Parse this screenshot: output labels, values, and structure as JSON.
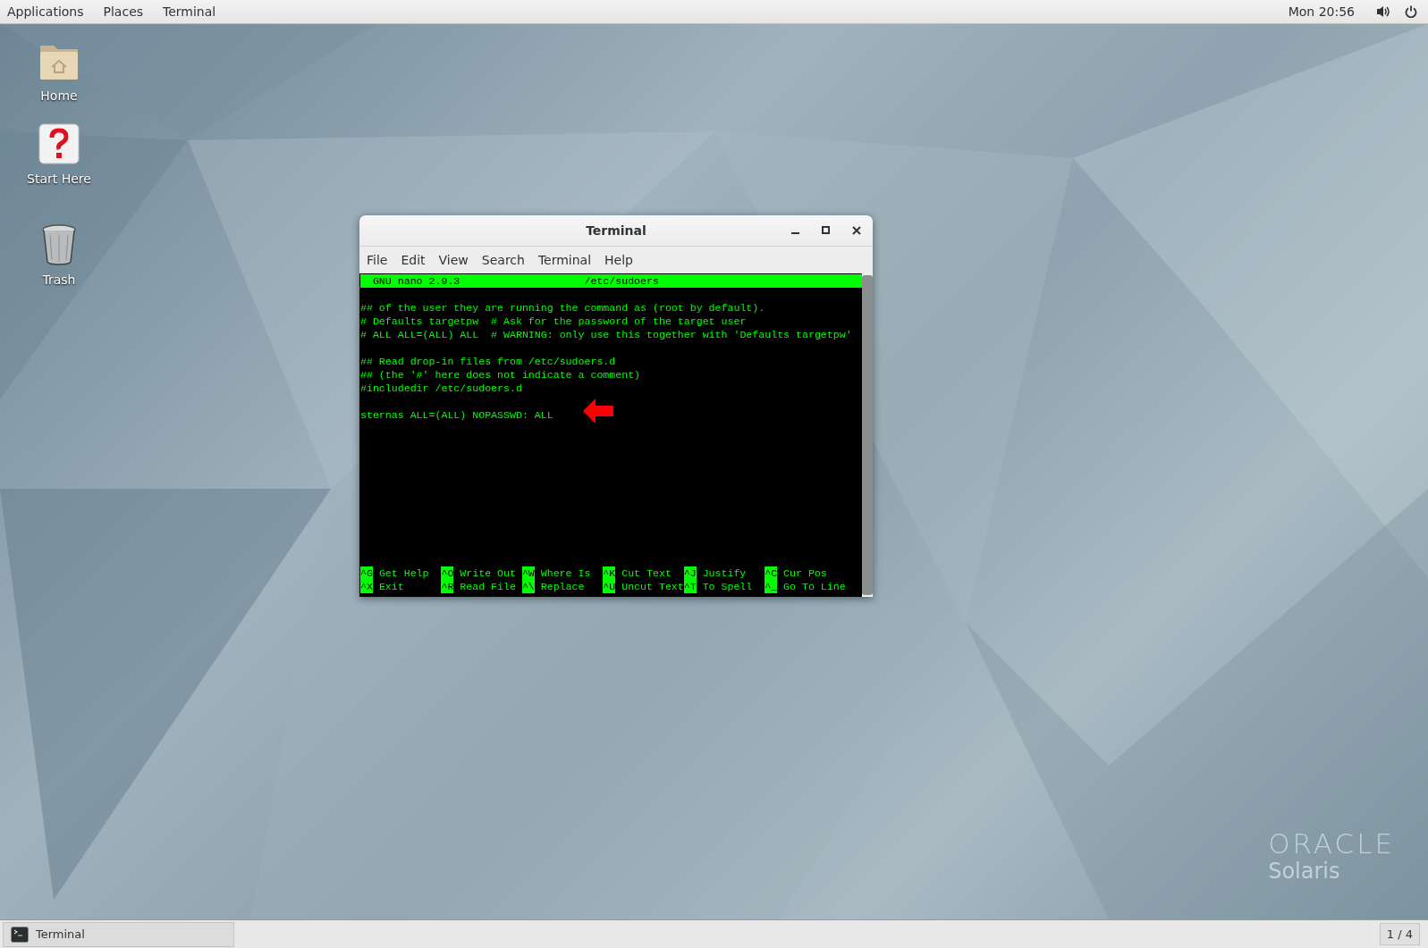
{
  "top_bar": {
    "menus": [
      "Applications",
      "Places",
      "Terminal"
    ],
    "clock": "Mon 20:56"
  },
  "desktop_icons": [
    {
      "kind": "home",
      "label": "Home"
    },
    {
      "kind": "help",
      "label": "Start Here"
    },
    {
      "kind": "trash",
      "label": "Trash"
    }
  ],
  "terminal": {
    "title": "Terminal",
    "menus": [
      "File",
      "Edit",
      "View",
      "Search",
      "Terminal",
      "Help"
    ],
    "nano": {
      "version": "GNU nano 2.9.3",
      "file": "/etc/sudoers",
      "blocks": [
        [
          "## of the user they are running the command as (root by default).",
          "# Defaults targetpw  # Ask for the password of the target user",
          "# ALL ALL=(ALL) ALL  # WARNING: only use this together with 'Defaults targetpw'"
        ],
        [
          "## Read drop-in files from /etc/sudoers.d",
          "## (the '#' here does not indicate a comment)",
          "#includedir /etc/sudoers.d"
        ],
        [
          "sternas ALL=(ALL) NOPASSWD: ALL"
        ]
      ],
      "shortcuts": [
        [
          {
            "key": "^G",
            "label": "Get Help"
          },
          {
            "key": "^O",
            "label": "Write Out"
          },
          {
            "key": "^W",
            "label": "Where Is"
          },
          {
            "key": "^K",
            "label": "Cut Text"
          },
          {
            "key": "^J",
            "label": "Justify"
          },
          {
            "key": "^C",
            "label": "Cur Pos"
          }
        ],
        [
          {
            "key": "^X",
            "label": "Exit"
          },
          {
            "key": "^R",
            "label": "Read File"
          },
          {
            "key": "^\\",
            "label": "Replace"
          },
          {
            "key": "^U",
            "label": "Uncut Text"
          },
          {
            "key": "^T",
            "label": "To Spell"
          },
          {
            "key": "^_",
            "label": "Go To Line"
          }
        ]
      ]
    }
  },
  "wallpaper_logo": {
    "brand": "ORACLE",
    "product": "Solaris"
  },
  "taskbar": {
    "tasks": [
      {
        "label": "Terminal"
      }
    ],
    "workspace": "1 / 4"
  }
}
